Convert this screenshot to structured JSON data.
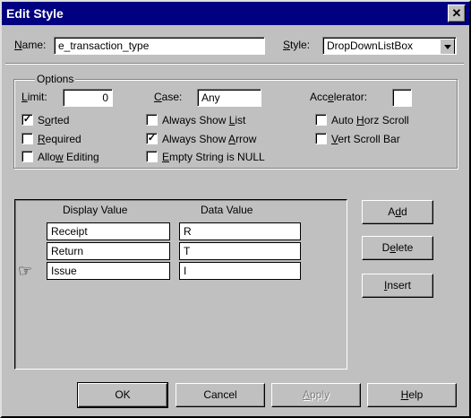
{
  "window": {
    "title": "Edit Style"
  },
  "header": {
    "name_label": "Name:",
    "name_value": "e_transaction_type",
    "style_label": "Style:",
    "style_value": "DropDownListBox"
  },
  "options": {
    "legend": "Options",
    "limit_label": "Limit:",
    "limit_value": "0",
    "case_label": "Case:",
    "case_value": "Any",
    "accelerator_label": "Accelerator:",
    "accelerator_value": "",
    "checkboxes": [
      {
        "label": "Sorted",
        "checked": true
      },
      {
        "label": "Required",
        "checked": false
      },
      {
        "label": "Allow Editing",
        "checked": false
      },
      {
        "label": "Always Show List",
        "checked": false
      },
      {
        "label": "Always Show Arrow",
        "checked": true
      },
      {
        "label": "Empty String is NULL",
        "checked": false
      },
      {
        "label": "Auto Horz Scroll",
        "checked": false
      },
      {
        "label": "Vert Scroll Bar",
        "checked": false
      }
    ]
  },
  "values_table": {
    "columns": [
      "Display Value",
      "Data Value"
    ],
    "rows": [
      {
        "display": "Receipt",
        "data": "R"
      },
      {
        "display": "Return",
        "data": "T"
      },
      {
        "display": "Issue",
        "data": "I"
      }
    ]
  },
  "side_buttons": {
    "add": "Add",
    "delete": "Delete",
    "insert": "Insert"
  },
  "footer_buttons": {
    "ok": "OK",
    "cancel": "Cancel",
    "apply": "Apply",
    "help": "Help"
  },
  "icons": {
    "close": "close-icon",
    "pointer": "pointing-hand-icon",
    "dropdown": "chevron-down-icon"
  }
}
